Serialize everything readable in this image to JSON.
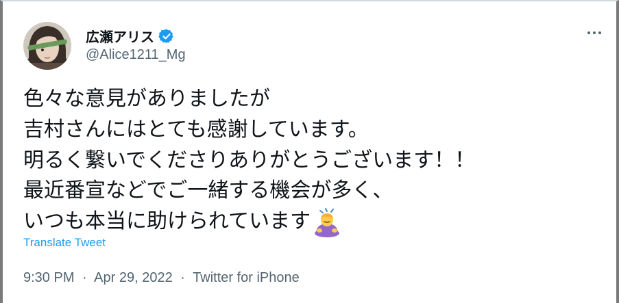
{
  "author": {
    "display_name": "広瀬アリス",
    "handle": "@Alice1211_Mg",
    "verified_icon": "verified-badge-icon",
    "verified_color": "#1d9bf0"
  },
  "tweet": {
    "lines": [
      "色々な意見がありましたが",
      "吉村さんにはとても感謝しています。",
      "明るく繋いでくださりありがとうございます！！",
      "最近番宣などでご一緒する機会が多く、",
      "いつも本当に助けられています"
    ],
    "trailing_emoji": "person-bowing-emoji"
  },
  "translate_label": "Translate Tweet",
  "meta": {
    "time": "9:30 PM",
    "separator": "·",
    "date": "Apr 29, 2022",
    "source": "Twitter for iPhone"
  },
  "more_icon": "more-horizontal-icon"
}
